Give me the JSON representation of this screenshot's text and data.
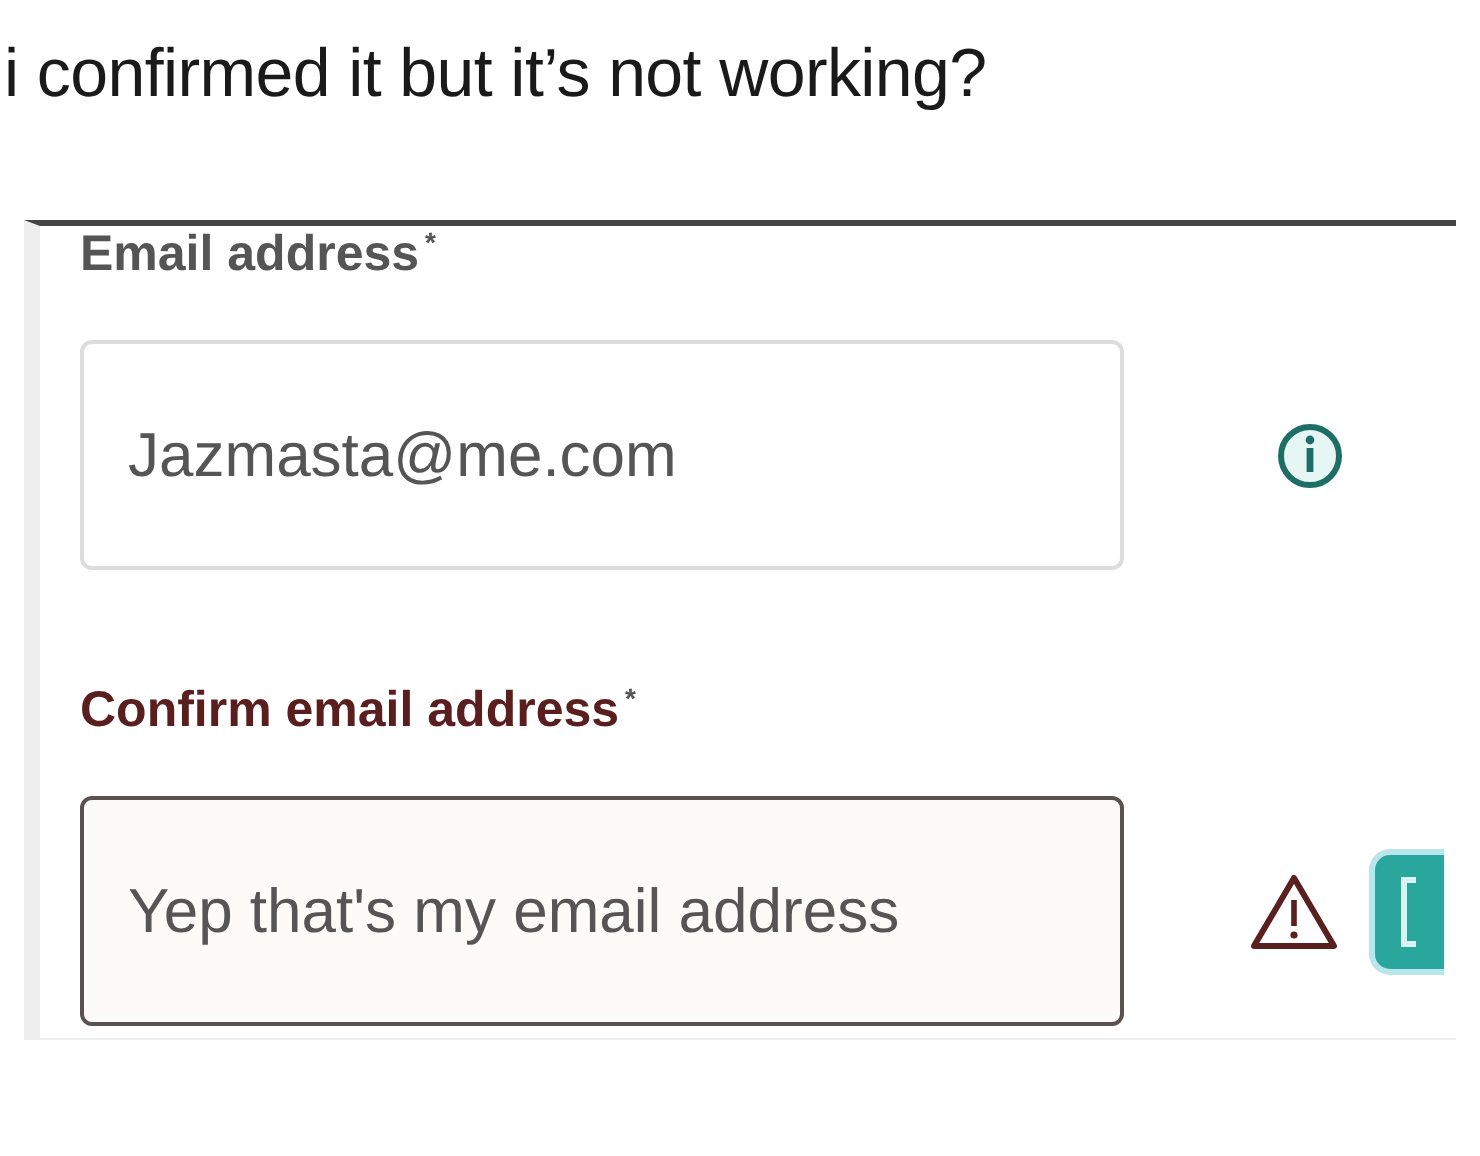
{
  "caption": "i confirmed it but it’s not working?",
  "fields": [
    {
      "label": "Email address",
      "required_mark": "*",
      "value": "Jazmasta@me.com",
      "error": false
    },
    {
      "label": "Confirm email address",
      "required_mark": "*",
      "value": "Yep that's my email address",
      "error": true
    }
  ]
}
